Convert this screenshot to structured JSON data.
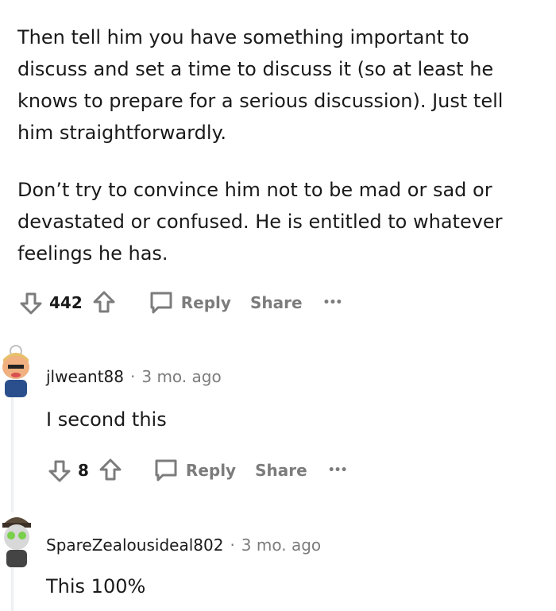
{
  "comment_main": {
    "paragraph1": "Then tell him you have something important to discuss and set a time to discuss it (so at least he knows to prepare for a serious discussion). Just tell him straightforwardly.",
    "paragraph2": "Don’t try to convince him not to be mad or sad or devastated or confused. He is entitled to whatever feelings he has.",
    "vote_count": "442",
    "reply_label": "Reply",
    "share_label": "Share",
    "more_label": "•••"
  },
  "reply1": {
    "username": "jlweant88",
    "separator": "·",
    "time": "3 mo. ago",
    "text": "I second this",
    "vote_count": "8",
    "reply_label": "Reply",
    "share_label": "Share",
    "more_label": "•••"
  },
  "reply2": {
    "username": "SpareZealousideal802",
    "separator": "·",
    "time": "3 mo. ago",
    "text": "This 100%"
  },
  "icons": {
    "upvote": "upvote-icon",
    "downvote": "downvote-icon",
    "reply": "comment-bubble-icon",
    "more": "more-dots-icon"
  }
}
